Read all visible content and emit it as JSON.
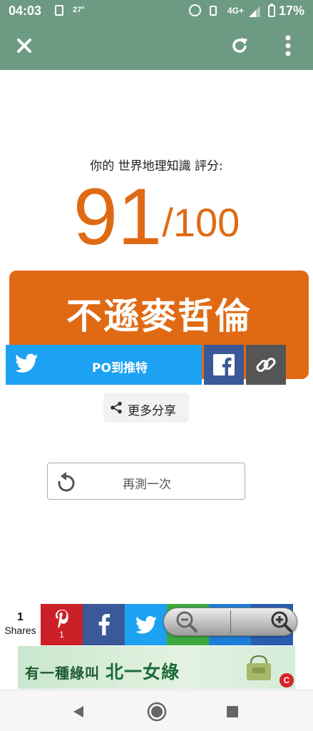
{
  "status_bar": {
    "time": "04:03",
    "temperature": "27°",
    "network": "4G+",
    "battery_percent": "17%"
  },
  "toolbar": {
    "close_icon": "close-icon",
    "reload_icon": "reload-icon",
    "menu_icon": "more-vert-icon"
  },
  "result": {
    "label": "你的 世界地理知識 評分:",
    "score": "91",
    "score_max": "/100",
    "rank": "不遜麥哲倫"
  },
  "share": {
    "twitter_label": "PO到推特",
    "more_label": "更多分享"
  },
  "retry": {
    "label": "再測一次"
  },
  "bottom_share": {
    "count": "1",
    "count_label": "Shares",
    "pinterest_count": "1"
  },
  "banner": {
    "text_prefix": "有一種綠叫",
    "text_brand": "北一女綠",
    "logo_letter": "C"
  },
  "colors": {
    "toolbar": "#6c9a82",
    "accent_orange": "#e06a14",
    "twitter": "#1da1f2",
    "facebook": "#3b5998",
    "pinterest": "#cb2027"
  }
}
